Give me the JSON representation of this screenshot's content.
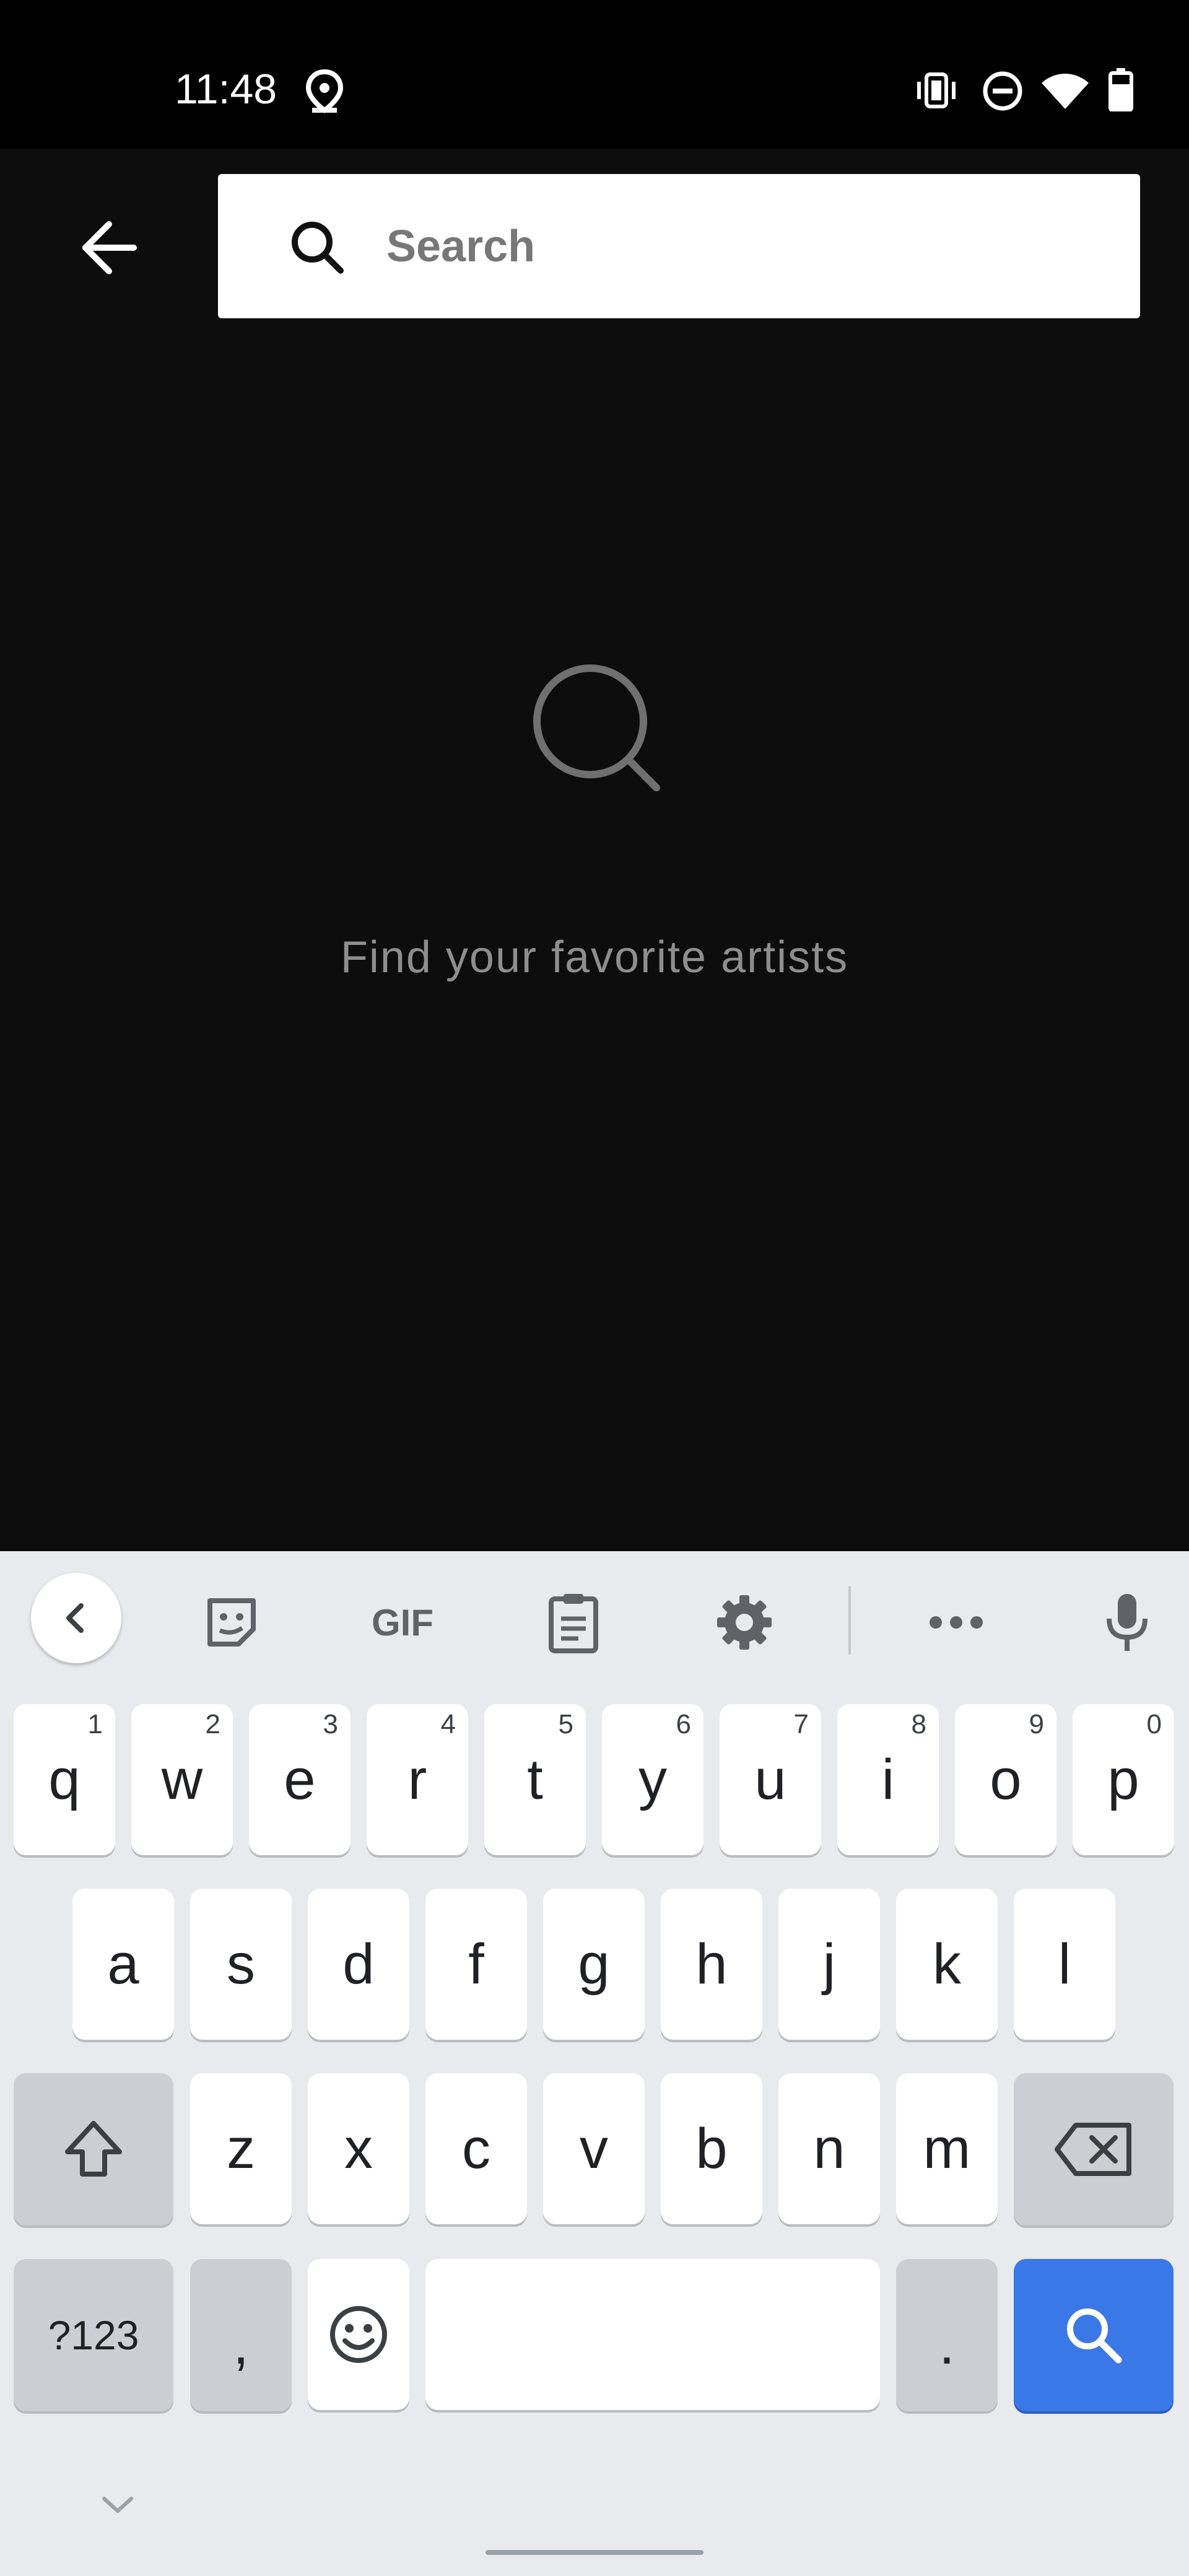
{
  "status_bar": {
    "time": "11:48",
    "icons": [
      "location-icon",
      "vibrate-icon",
      "do-not-disturb-icon",
      "wifi-icon",
      "battery-icon"
    ]
  },
  "header": {
    "back_icon": "back-arrow-icon",
    "search": {
      "placeholder": "Search",
      "value": ""
    }
  },
  "empty_state": {
    "icon": "search-icon",
    "message": "Find your favorite artists"
  },
  "keyboard": {
    "toolbar": [
      "collapse-chevron-icon",
      "sticker-icon",
      "GIF",
      "clipboard-icon",
      "settings-icon",
      "more-icon",
      "mic-icon"
    ],
    "gif_label": "GIF",
    "row1": [
      {
        "key": "q",
        "hint": "1"
      },
      {
        "key": "w",
        "hint": "2"
      },
      {
        "key": "e",
        "hint": "3"
      },
      {
        "key": "r",
        "hint": "4"
      },
      {
        "key": "t",
        "hint": "5"
      },
      {
        "key": "y",
        "hint": "6"
      },
      {
        "key": "u",
        "hint": "7"
      },
      {
        "key": "i",
        "hint": "8"
      },
      {
        "key": "o",
        "hint": "9"
      },
      {
        "key": "p",
        "hint": "0"
      }
    ],
    "row2": [
      "a",
      "s",
      "d",
      "f",
      "g",
      "h",
      "j",
      "k",
      "l"
    ],
    "row3": [
      "z",
      "x",
      "c",
      "v",
      "b",
      "n",
      "m"
    ],
    "symbols_label": "?123",
    "comma_label": ",",
    "period_label": ".",
    "colors": {
      "background": "#e8eaed",
      "action": "#3b78e7"
    }
  }
}
